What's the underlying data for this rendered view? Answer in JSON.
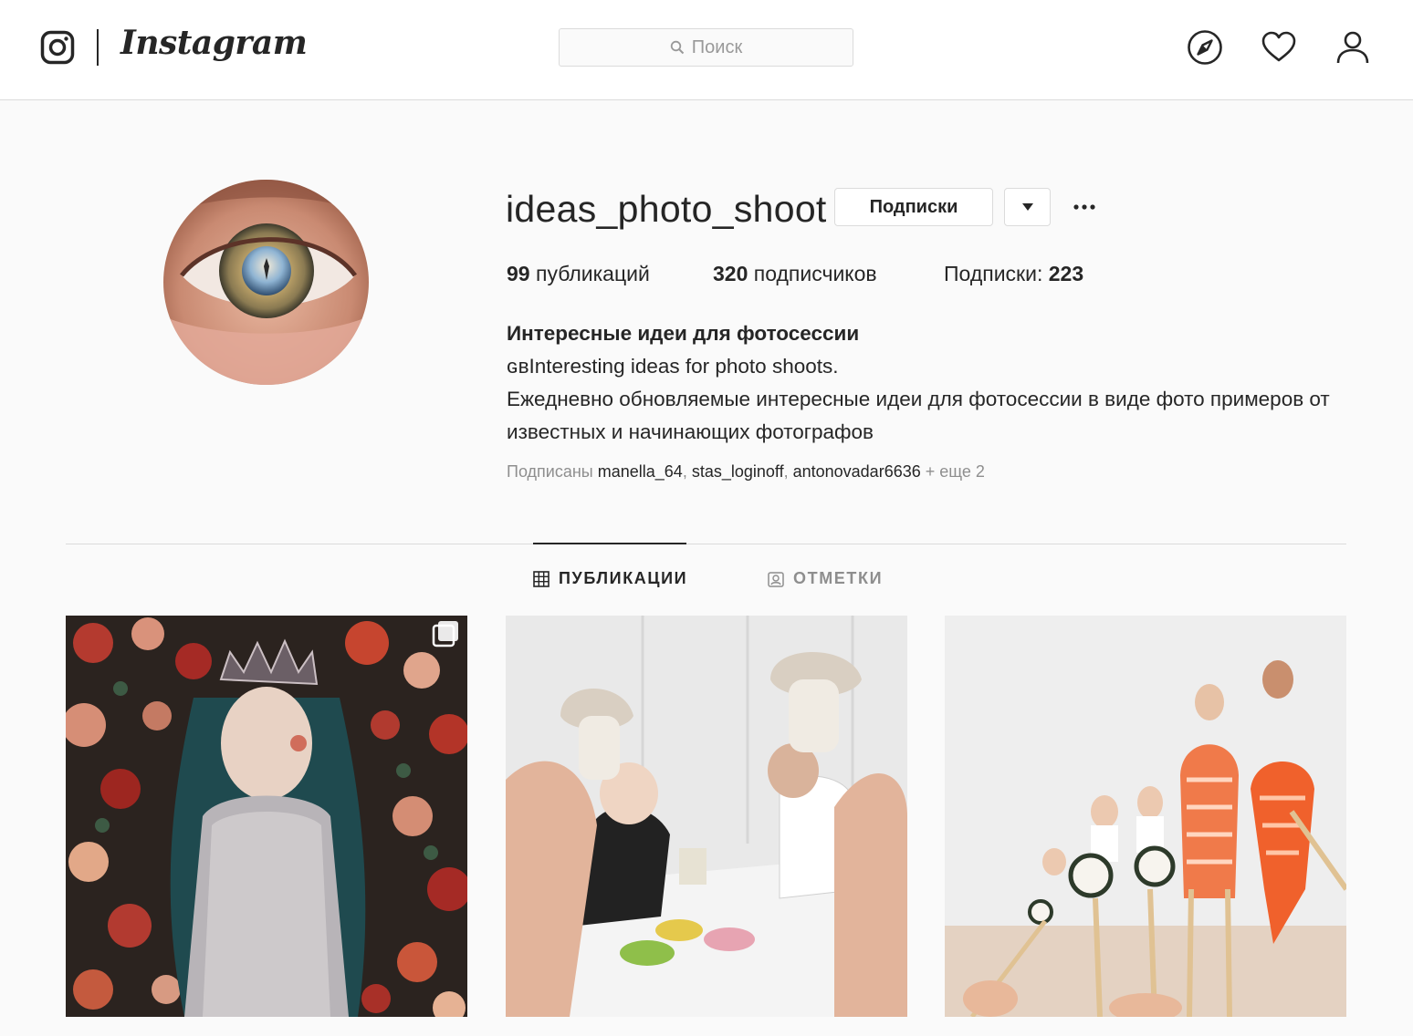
{
  "header": {
    "brand": "Instagram",
    "search_placeholder": "Поиск",
    "icons": [
      "instagram-glyph-icon",
      "search-icon",
      "compass-icon",
      "heart-icon",
      "user-icon"
    ]
  },
  "profile": {
    "username": "ideas_photo_shoot",
    "follow_button": "Подписки",
    "more": "···",
    "stats": {
      "posts_count": "99",
      "posts_label": " публикаций",
      "followers_count": "320",
      "followers_label": " подписчиков",
      "following_label": "Подписки: ",
      "following_count": "223"
    },
    "bio": {
      "name": "Интересные идеи для фотосессии",
      "line1": "ɢвInteresting ideas for photo shoots.",
      "line2": "Ежедневно обновляемые интересные идеи для фотосессии в виде фото примеров от известных и начинающих фотографов"
    },
    "followed_by": {
      "prefix": "Подписаны ",
      "user1": "manella_64",
      "sep1": ", ",
      "user2": "stas_loginoff",
      "sep2": ", ",
      "user3": "antonovadar6636",
      "suffix": " + еще 2"
    }
  },
  "tabs": {
    "posts": "ПУБЛИКАЦИИ",
    "tagged": "ОТМЕТКИ"
  },
  "colors": {
    "background": "#fafafa",
    "border": "#dbdbdb",
    "text": "#262626",
    "muted": "#8e8e8e"
  }
}
